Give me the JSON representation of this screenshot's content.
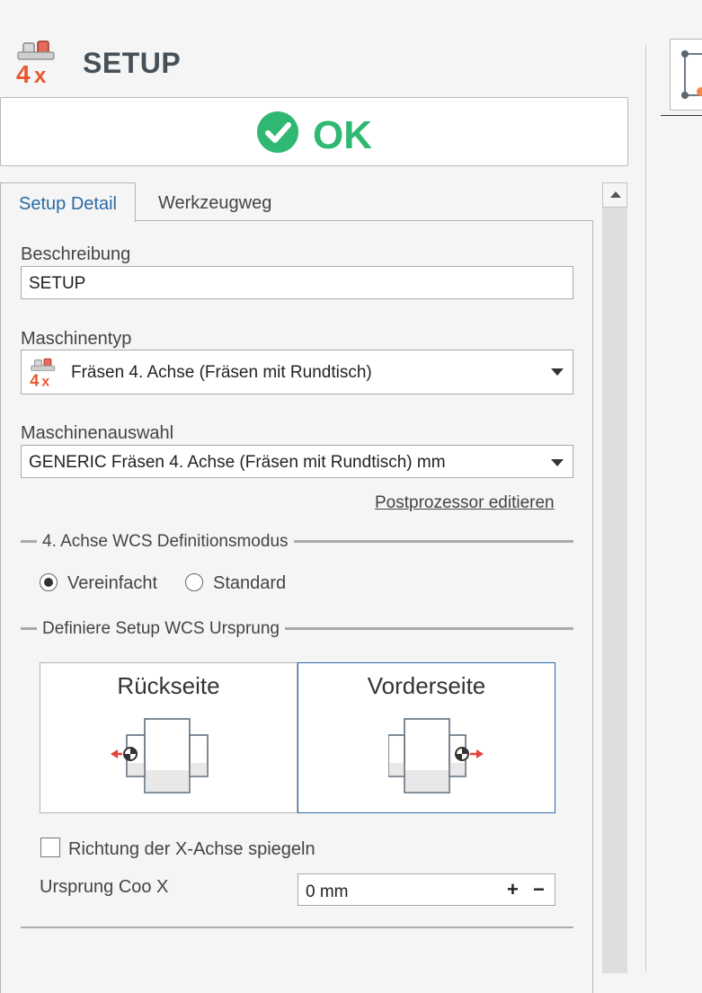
{
  "header": {
    "title": "SETUP",
    "icon": "machine-4x-icon"
  },
  "status": {
    "text": "OK",
    "icon": "check-circle-icon",
    "color": "#2fb872"
  },
  "tabs": [
    {
      "label": "Setup Detail",
      "active": true
    },
    {
      "label": "Werkzeugweg",
      "active": false
    }
  ],
  "form": {
    "beschreibung_label": "Beschreibung",
    "beschreibung_value": "SETUP",
    "maschinentyp_label": "Maschinentyp",
    "maschinentyp_value": "Fräsen 4. Achse (Fräsen mit Rundtisch)",
    "maschinenauswahl_label": "Maschinenauswahl",
    "maschinenauswahl_value": "GENERIC Fräsen 4. Achse (Fräsen mit Rundtisch) mm",
    "postprozessor_link": "Postprozessor editieren"
  },
  "wcs_mode": {
    "title": "4. Achse WCS Definitionsmodus",
    "options": [
      {
        "label": "Vereinfacht",
        "selected": true
      },
      {
        "label": "Standard",
        "selected": false
      }
    ]
  },
  "origin": {
    "title": "Definiere Setup WCS Ursprung",
    "cards": [
      {
        "label": "Rückseite",
        "selected": false
      },
      {
        "label": "Vorderseite",
        "selected": true
      }
    ],
    "mirror_label": "Richtung der X-Achse spiegeln",
    "mirror_checked": false,
    "coo_label": "Ursprung Coo X",
    "coo_value": "0 mm",
    "plus_label": "+",
    "minus_label": "−"
  },
  "colors": {
    "accent": "#2b6aa6",
    "ok_green": "#2fb872",
    "arrow_red": "#e8413b"
  }
}
